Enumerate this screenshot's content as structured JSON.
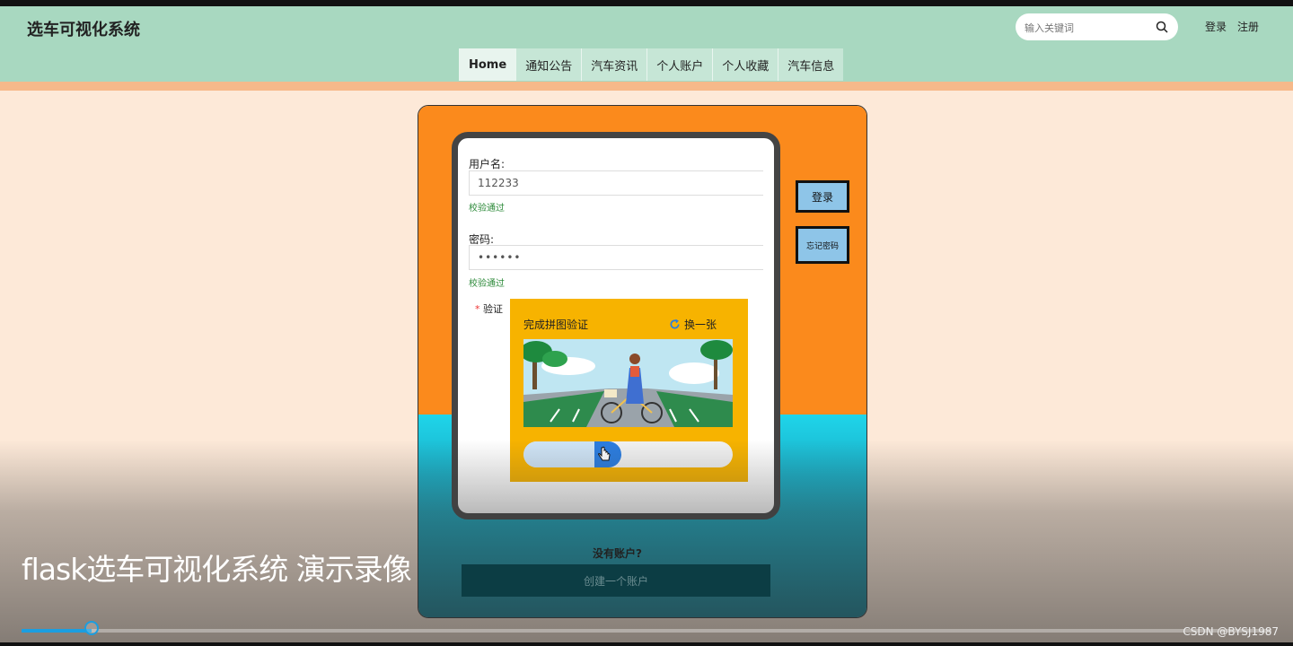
{
  "header": {
    "site_title": "选车可视化系统",
    "search_placeholder": "输入关键词",
    "login": "登录",
    "register": "注册"
  },
  "nav": {
    "items": [
      {
        "label": "Home",
        "active": true
      },
      {
        "label": "通知公告",
        "active": false
      },
      {
        "label": "汽车资讯",
        "active": false
      },
      {
        "label": "个人账户",
        "active": false
      },
      {
        "label": "个人收藏",
        "active": false
      },
      {
        "label": "汽车信息",
        "active": false
      }
    ]
  },
  "form": {
    "username_label": "用户名:",
    "username_value": "112233",
    "username_status": "校验通过",
    "password_label": "密码:",
    "password_value": "••••••",
    "password_status": "校验通过",
    "verify_label": "验证",
    "required_mark": "*"
  },
  "captcha": {
    "title": "完成拼图验证",
    "refresh_label": "换一张"
  },
  "side_buttons": {
    "login": "登录",
    "forgot": "忘记密码"
  },
  "footer": {
    "no_account": "没有账户?",
    "create_account": "创建一个账户"
  },
  "video": {
    "title": "flask选车可视化系统 演示录像",
    "progress": 0.056,
    "watermark": "CSDN @BYSJ1987"
  },
  "colors": {
    "header_bg": "#a8d8c0",
    "card_orange": "#fb8a1c",
    "card_teal": "#1fd5ea",
    "captcha_bg": "#f7b300",
    "button_blue": "#8ec5e8",
    "progress_blue": "#1b9ee0"
  },
  "icons": {
    "search": "search-icon",
    "refresh": "refresh-icon",
    "cursor": "hand-cursor-icon"
  }
}
